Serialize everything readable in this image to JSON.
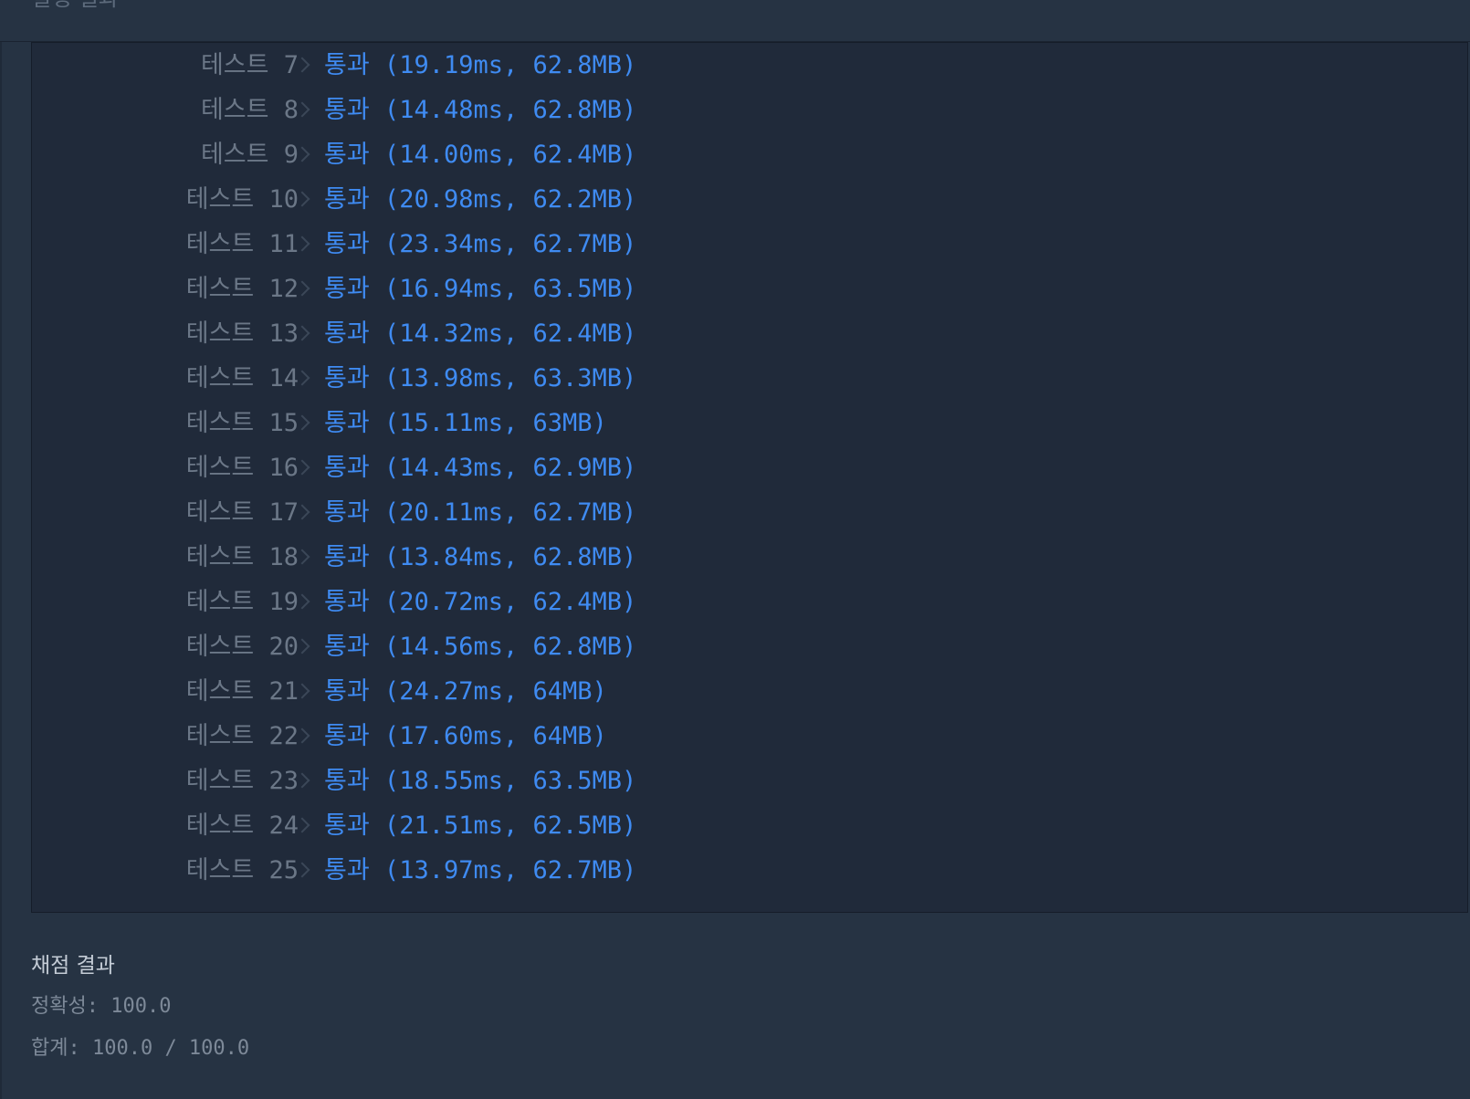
{
  "header": {
    "title": "실행 결과"
  },
  "tests": [
    {
      "label": "테스트 7",
      "result": "통과 (19.19ms, 62.8MB)"
    },
    {
      "label": "테스트 8",
      "result": "통과 (14.48ms, 62.8MB)"
    },
    {
      "label": "테스트 9",
      "result": "통과 (14.00ms, 62.4MB)"
    },
    {
      "label": "테스트 10",
      "result": "통과 (20.98ms, 62.2MB)"
    },
    {
      "label": "테스트 11",
      "result": "통과 (23.34ms, 62.7MB)"
    },
    {
      "label": "테스트 12",
      "result": "통과 (16.94ms, 63.5MB)"
    },
    {
      "label": "테스트 13",
      "result": "통과 (14.32ms, 62.4MB)"
    },
    {
      "label": "테스트 14",
      "result": "통과 (13.98ms, 63.3MB)"
    },
    {
      "label": "테스트 15",
      "result": "통과 (15.11ms, 63MB)"
    },
    {
      "label": "테스트 16",
      "result": "통과 (14.43ms, 62.9MB)"
    },
    {
      "label": "테스트 17",
      "result": "통과 (20.11ms, 62.7MB)"
    },
    {
      "label": "테스트 18",
      "result": "통과 (13.84ms, 62.8MB)"
    },
    {
      "label": "테스트 19",
      "result": "통과 (20.72ms, 62.4MB)"
    },
    {
      "label": "테스트 20",
      "result": "통과 (14.56ms, 62.8MB)"
    },
    {
      "label": "테스트 21",
      "result": "통과 (24.27ms, 64MB)"
    },
    {
      "label": "테스트 22",
      "result": "통과 (17.60ms, 64MB)"
    },
    {
      "label": "테스트 23",
      "result": "통과 (18.55ms, 63.5MB)"
    },
    {
      "label": "테스트 24",
      "result": "통과 (21.51ms, 62.5MB)"
    },
    {
      "label": "테스트 25",
      "result": "통과 (13.97ms, 62.7MB)"
    }
  ],
  "grading": {
    "title": "채점 결과",
    "accuracy": "정확성: 100.0",
    "total": "합계: 100.0 / 100.0"
  },
  "colors": {
    "background": "#263343",
    "panel": "#202a3a",
    "pass": "#3f8bf2",
    "label": "#6b7787"
  }
}
